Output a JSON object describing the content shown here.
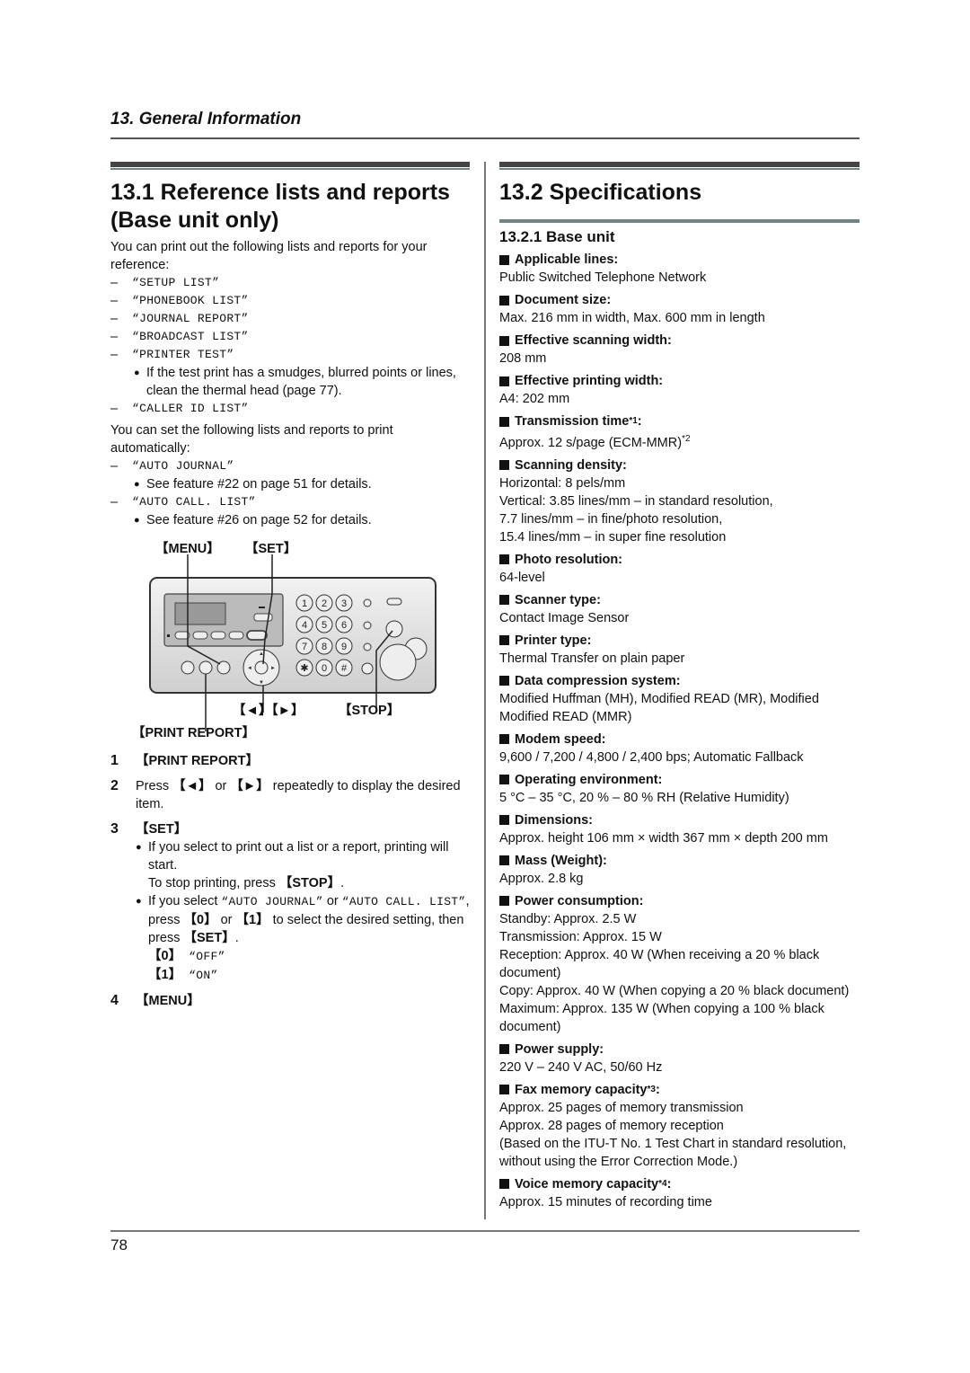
{
  "header": {
    "chapter": "13. General Information"
  },
  "footer": {
    "page_number": "78"
  },
  "left": {
    "title": "13.1 Reference lists and reports (Base unit only)",
    "intro": "You can print out the following lists and reports for your reference:",
    "lists": [
      {
        "dash": "–",
        "name": "“SETUP LIST”"
      },
      {
        "dash": "–",
        "name": "“PHONEBOOK LIST”"
      },
      {
        "dash": "–",
        "name": "“JOURNAL REPORT”"
      },
      {
        "dash": "–",
        "name": "“BROADCAST LIST”"
      },
      {
        "dash": "–",
        "name": "“PRINTER TEST”"
      }
    ],
    "printer_test_note": "If the test print has a smudges, blurred points or lines, clean the thermal head (page 77).",
    "caller_id": "“CALLER ID LIST”",
    "auto_intro": "You can set the following lists and reports to print automatically:",
    "auto_journal": "“AUTO JOURNAL”",
    "auto_journal_note": "See feature #22 on page 51 for details.",
    "auto_call": "“AUTO CALL. LIST”",
    "auto_call_note": "See feature #26 on page 52 for details.",
    "diagram": {
      "menu": "【MENU】",
      "set": "【SET】",
      "arrows": "【◄】【►】",
      "stop": "【STOP】",
      "print_report": "【PRINT REPORT】",
      "keypad": [
        "1",
        "2",
        "3",
        "4",
        "5",
        "6",
        "7",
        "8",
        "9",
        "✱",
        "0",
        "#"
      ]
    },
    "steps": [
      {
        "num": "1",
        "key": "【PRINT REPORT】"
      },
      {
        "num": "2",
        "pre": "Press ",
        "k1": "【◄】",
        "mid": " or ",
        "k2": "【►】",
        "post": " repeatedly to display the desired item."
      },
      {
        "num": "3",
        "key": "【SET】"
      },
      {
        "num": "4",
        "key": "【MENU】"
      }
    ],
    "step3": {
      "b1": "If you select to print out a list or a report, printing will start.",
      "stop_pre": "To stop printing, press ",
      "stop_key": "【STOP】",
      "stop_post": ".",
      "b2_pre": "If you select ",
      "b2_m1": "“AUTO JOURNAL”",
      "b2_or": " or ",
      "b2_m2": "“AUTO CALL. LIST”",
      "b2_mid": ", press ",
      "b2_k0": "【0】",
      "b2_or2": " or ",
      "b2_k1": "【1】",
      "b2_post": " to select the desired setting, then press ",
      "b2_kset": "【SET】",
      "b2_end": ".",
      "opt0_key": "【0】",
      "opt0_val": " “OFF”",
      "opt1_key": "【1】",
      "opt1_val": " “ON”"
    }
  },
  "right": {
    "title": "13.2 Specifications",
    "subtitle": "13.2.1 Base unit",
    "specs": [
      {
        "label": "Applicable lines:",
        "values": [
          "Public Switched Telephone Network"
        ]
      },
      {
        "label": "Document size:",
        "values": [
          "Max. 216 mm in width, Max. 600 mm in length"
        ]
      },
      {
        "label": "Effective scanning width:",
        "values": [
          "208 mm"
        ]
      },
      {
        "label": "Effective printing width:",
        "values": [
          "A4: 202 mm"
        ]
      },
      {
        "label": "Transmission time",
        "sup": "*1",
        "values": [
          "Approx. 12 s/page (ECM-MMR)"
        ],
        "value_sup": "*2"
      },
      {
        "label": "Scanning density:",
        "values": [
          "Horizontal: 8 pels/mm",
          "Vertical: 3.85 lines/mm – in standard resolution,",
          "7.7 lines/mm – in fine/photo resolution,",
          "15.4 lines/mm – in super fine resolution"
        ]
      },
      {
        "label": "Photo resolution:",
        "values": [
          "64-level"
        ]
      },
      {
        "label": "Scanner type:",
        "values": [
          "Contact Image Sensor"
        ]
      },
      {
        "label": "Printer type:",
        "values": [
          "Thermal Transfer on plain paper"
        ]
      },
      {
        "label": "Data compression system:",
        "values": [
          "Modified Huffman (MH), Modified READ (MR), Modified Modified READ (MMR)"
        ]
      },
      {
        "label": "Modem speed:",
        "values": [
          "9,600 / 7,200 / 4,800 / 2,400 bps; Automatic Fallback"
        ]
      },
      {
        "label": "Operating environment:",
        "values": [
          "5 °C – 35 °C, 20 % – 80 % RH (Relative Humidity)"
        ]
      },
      {
        "label": "Dimensions:",
        "values": [
          "Approx. height 106 mm × width 367 mm × depth 200 mm"
        ]
      },
      {
        "label": "Mass (Weight):",
        "values": [
          "Approx. 2.8 kg"
        ]
      },
      {
        "label": "Power consumption:",
        "values": [
          "Standby: Approx. 2.5 W",
          "Transmission: Approx. 15 W",
          "Reception: Approx. 40 W (When receiving a 20 % black document)",
          "Copy: Approx. 40 W (When copying a 20 % black document)",
          "Maximum: Approx. 135 W (When copying a 100 % black document)"
        ]
      },
      {
        "label": "Power supply:",
        "values": [
          "220 V – 240 V AC, 50/60 Hz"
        ]
      },
      {
        "label": "Fax memory capacity",
        "sup": "*3",
        "values": [
          "Approx. 25 pages of memory transmission",
          "Approx. 28 pages of memory reception",
          "(Based on the ITU-T No. 1 Test Chart in standard resolution, without using the Error Correction Mode.)"
        ]
      },
      {
        "label": "Voice memory capacity",
        "sup": "*4",
        "values": [
          "Approx. 15 minutes of recording time"
        ]
      }
    ]
  }
}
